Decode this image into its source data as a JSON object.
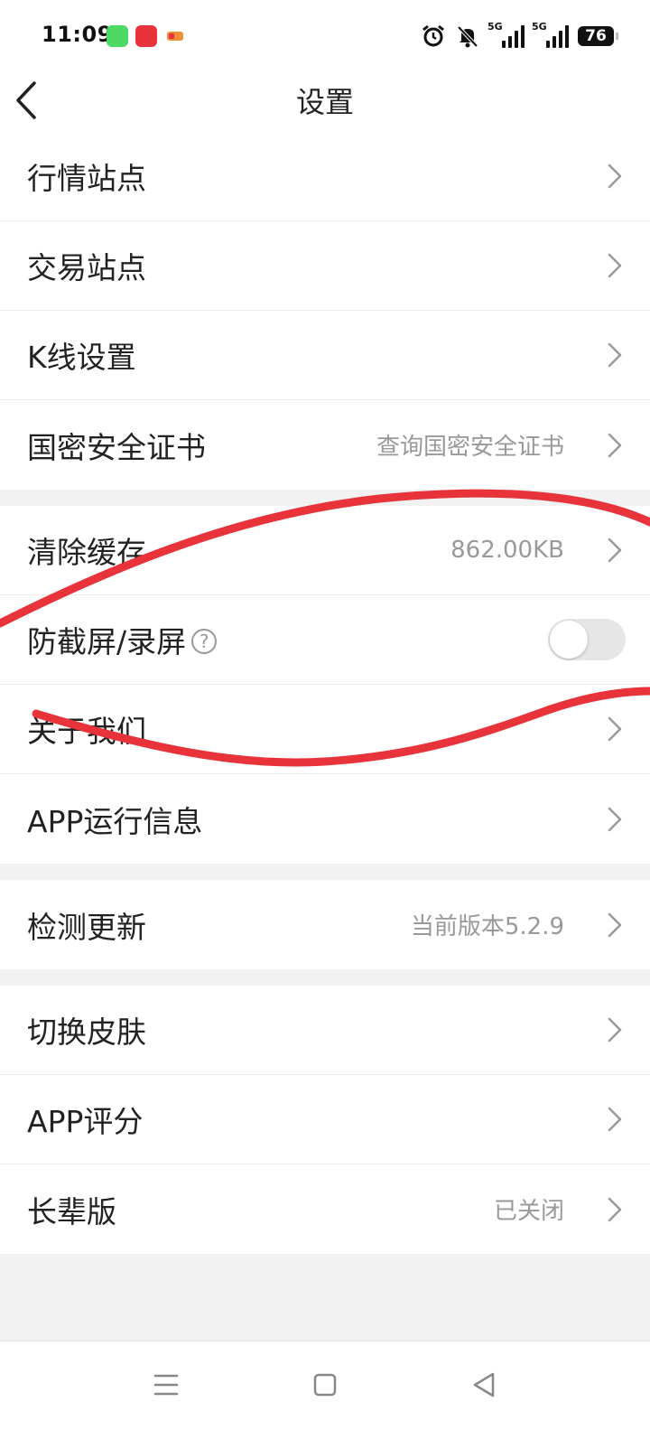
{
  "status_bar": {
    "time": "11:09",
    "network_1": "5G",
    "network_2": "5G",
    "battery": "76"
  },
  "header": {
    "title": "设置"
  },
  "groups": [
    {
      "rows": [
        {
          "label": "行情站点",
          "value": ""
        },
        {
          "label": "交易站点",
          "value": ""
        },
        {
          "label": "K线设置",
          "value": ""
        },
        {
          "label": "国密安全证书",
          "value": "查询国密安全证书"
        }
      ]
    },
    {
      "rows": [
        {
          "label": "清除缓存",
          "value": "862.00KB"
        },
        {
          "label": "防截屏/录屏",
          "help": "?",
          "toggle_on": false
        },
        {
          "label": "关于我们",
          "value": ""
        },
        {
          "label": "APP运行信息",
          "value": ""
        }
      ]
    },
    {
      "rows": [
        {
          "label": "检测更新",
          "value": "当前版本5.2.9"
        }
      ]
    },
    {
      "rows": [
        {
          "label": "切换皮肤",
          "value": ""
        },
        {
          "label": "APP评分",
          "value": ""
        },
        {
          "label": "长辈版",
          "value": "已关闭"
        }
      ]
    }
  ],
  "colors": {
    "background": "#f2f2f2",
    "row_bg": "#ffffff",
    "text": "#222222",
    "secondary_text": "#999999",
    "scribble": "#e8333a"
  },
  "icons": {
    "back": "chevron-left-icon",
    "row_arrow": "chevron-right-icon",
    "help": "question-circle-icon",
    "nav_menu": "menu-icon",
    "nav_home": "square-home-icon",
    "nav_back": "triangle-back-icon"
  }
}
